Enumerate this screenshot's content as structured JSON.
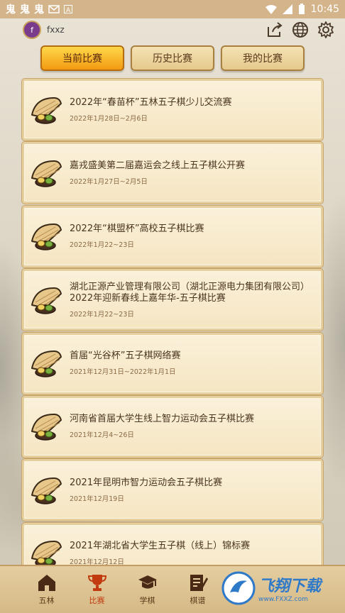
{
  "status_bar": {
    "time": "10:45",
    "left_icons": [
      "鬼",
      "鬼",
      "鬼"
    ],
    "colors": {
      "bg": "#d4b48a"
    }
  },
  "header": {
    "avatar_letter": "f",
    "username": "fxxz"
  },
  "tabs": [
    {
      "label": "当前比赛",
      "active": true
    },
    {
      "label": "历史比赛",
      "active": false
    },
    {
      "label": "我的比赛",
      "active": false
    }
  ],
  "matches": [
    {
      "title": "2022年“春苗杯”五林五子棋少儿交流赛",
      "date": "2022年1月28日~2月6日"
    },
    {
      "title": "嘉戎盛美第二届嘉运会之线上五子棋公开赛",
      "date": "2022年1月27日~2月5日"
    },
    {
      "title": "2022年“棋盟杯”高校五子棋比赛",
      "date": "2022年1月22~23日"
    },
    {
      "title": "湖北正源产业管理有限公司（湖北正源电力集团有限公司）2022年迎新春线上嘉年华-五子棋比赛",
      "date": "2022年1月22~23日"
    },
    {
      "title": "首届“光谷杯”五子棋网络赛",
      "date": "2021年12月31日~2022年1月1日"
    },
    {
      "title": "河南省首届大学生线上智力运动会五子棋比赛",
      "date": "2021年12月4~26日"
    },
    {
      "title": "2021年昆明市智力运动会五子棋比赛",
      "date": "2021年12月19日"
    },
    {
      "title": "2021年湖北省大学生五子棋（线上）锦标赛",
      "date": "2021年12月12日"
    }
  ],
  "bottom_nav": [
    {
      "label": "五林",
      "icon": "home-icon",
      "active": false
    },
    {
      "label": "比赛",
      "icon": "trophy-icon",
      "active": true
    },
    {
      "label": "学棋",
      "icon": "graduation-cap-icon",
      "active": false
    },
    {
      "label": "棋谱",
      "icon": "notebook-edit-icon",
      "active": false
    }
  ],
  "watermark": {
    "big": "飞翔下载",
    "small": "www.FXXZ.com"
  }
}
